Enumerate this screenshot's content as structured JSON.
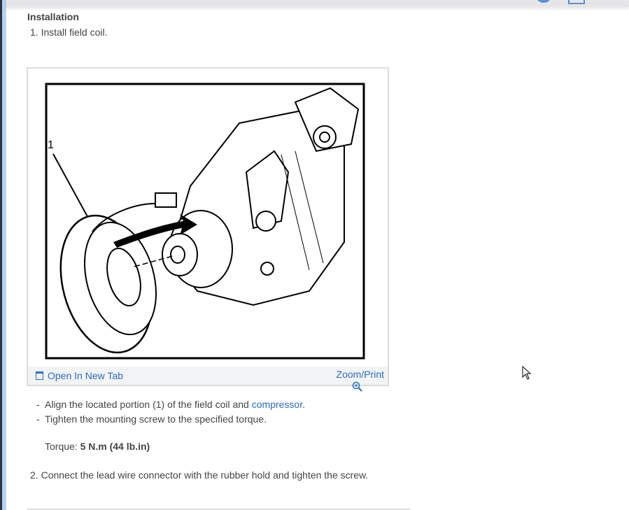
{
  "section_heading": "Installation",
  "steps": [
    {
      "number": "1.",
      "text": "Install field coil."
    },
    {
      "number": "2.",
      "text": "Connect the lead wire connector with the rubber hold and tighten the screw."
    }
  ],
  "figure": {
    "callout_label": "1",
    "open_in_new_tab_label": "Open In New Tab",
    "zoom_print_label": "Zoom/Print"
  },
  "bullets": [
    {
      "text_before": "Align the located portion (1) of the field coil and ",
      "link": "compressor",
      "text_after": "."
    },
    {
      "text": "Tighten the mounting screw to the specified torque."
    }
  ],
  "torque": {
    "label": "Torque: ",
    "value": "5 N.m (44 lb.in)"
  },
  "colors": {
    "link": "#2a6cc0",
    "text": "#444444"
  }
}
